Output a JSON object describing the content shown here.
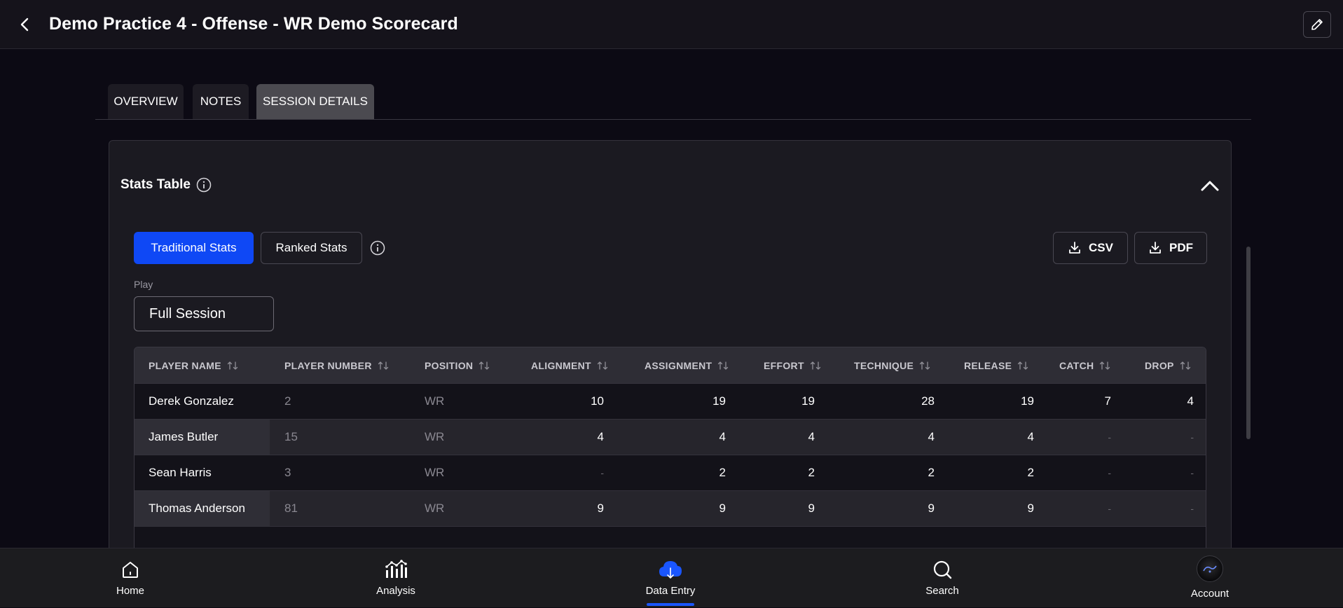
{
  "header": {
    "title": "Demo Practice 4 - Offense - WR Demo Scorecard"
  },
  "tabs": [
    {
      "label": "OVERVIEW",
      "active": false
    },
    {
      "label": "NOTES",
      "active": false
    },
    {
      "label": "SESSION DETAILS",
      "active": true
    }
  ],
  "stats_card": {
    "title": "Stats Table",
    "mode_buttons": {
      "traditional": "Traditional Stats",
      "ranked": "Ranked Stats"
    },
    "export": {
      "csv": "CSV",
      "pdf": "PDF"
    },
    "play_label": "Play",
    "play_value": "Full Session"
  },
  "table": {
    "columns": [
      "PLAYER NAME",
      "PLAYER NUMBER",
      "POSITION",
      "ALIGNMENT",
      "ASSIGNMENT",
      "EFFORT",
      "TECHNIQUE",
      "RELEASE",
      "CATCH",
      "DROP"
    ],
    "rows": [
      {
        "name": "Derek Gonzalez",
        "number": "2",
        "position": "WR",
        "alignment": "10",
        "assignment": "19",
        "effort": "19",
        "technique": "28",
        "release": "19",
        "catch": "7",
        "drop": "4"
      },
      {
        "name": "James Butler",
        "number": "15",
        "position": "WR",
        "alignment": "4",
        "assignment": "4",
        "effort": "4",
        "technique": "4",
        "release": "4",
        "catch": "-",
        "drop": "-"
      },
      {
        "name": "Sean Harris",
        "number": "3",
        "position": "WR",
        "alignment": "-",
        "assignment": "2",
        "effort": "2",
        "technique": "2",
        "release": "2",
        "catch": "-",
        "drop": "-"
      },
      {
        "name": "Thomas Anderson",
        "number": "81",
        "position": "WR",
        "alignment": "9",
        "assignment": "9",
        "effort": "9",
        "technique": "9",
        "release": "9",
        "catch": "-",
        "drop": "-"
      }
    ]
  },
  "bottom_nav": [
    {
      "label": "Home",
      "icon": "home-icon",
      "active": false
    },
    {
      "label": "Analysis",
      "icon": "analysis-icon",
      "active": false
    },
    {
      "label": "Data Entry",
      "icon": "cloud-upload-icon",
      "active": true
    },
    {
      "label": "Search",
      "icon": "search-icon",
      "active": false
    },
    {
      "label": "Account",
      "icon": "account-avatar",
      "active": false
    }
  ],
  "colors": {
    "accent": "#0f48f5",
    "nav_active": "#1a56ff",
    "background": "#0c0a14"
  }
}
